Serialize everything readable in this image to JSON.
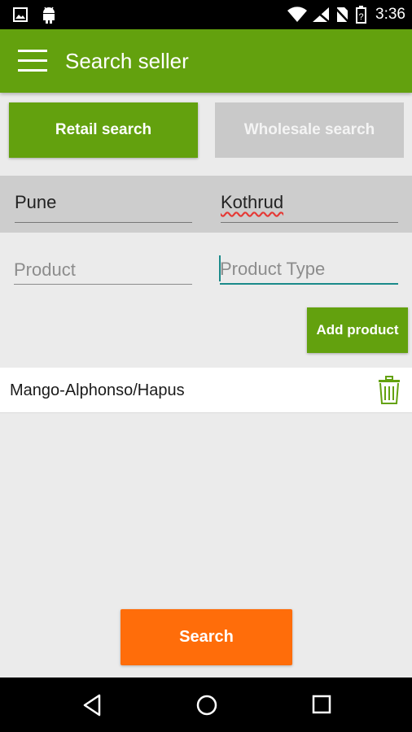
{
  "status_bar": {
    "time": "3:36",
    "icons": [
      "image-icon",
      "android-icon",
      "wifi-icon",
      "no-signal-icon",
      "no-sim-icon",
      "battery-icon"
    ]
  },
  "app_bar": {
    "title": "Search seller",
    "menu_icon": "hamburger-menu-icon"
  },
  "search_mode": {
    "retail_label": "Retail search",
    "wholesale_label": "Wholesale search",
    "active": "retail"
  },
  "location": {
    "city": "Pune",
    "area": "Kothrud"
  },
  "product_form": {
    "product_placeholder": "Product",
    "product_type_placeholder": "Product Type",
    "add_label": "Add product"
  },
  "products": [
    {
      "name": "Mango-Alphonso/Hapus",
      "action_icon": "trash-icon"
    }
  ],
  "search_label": "Search",
  "nav_bar": {
    "icons": [
      "back-icon",
      "home-icon",
      "recents-icon"
    ]
  },
  "colors": {
    "primary": "#63a10e",
    "accent": "#ff6d0a",
    "focus": "#1a8a8a"
  }
}
